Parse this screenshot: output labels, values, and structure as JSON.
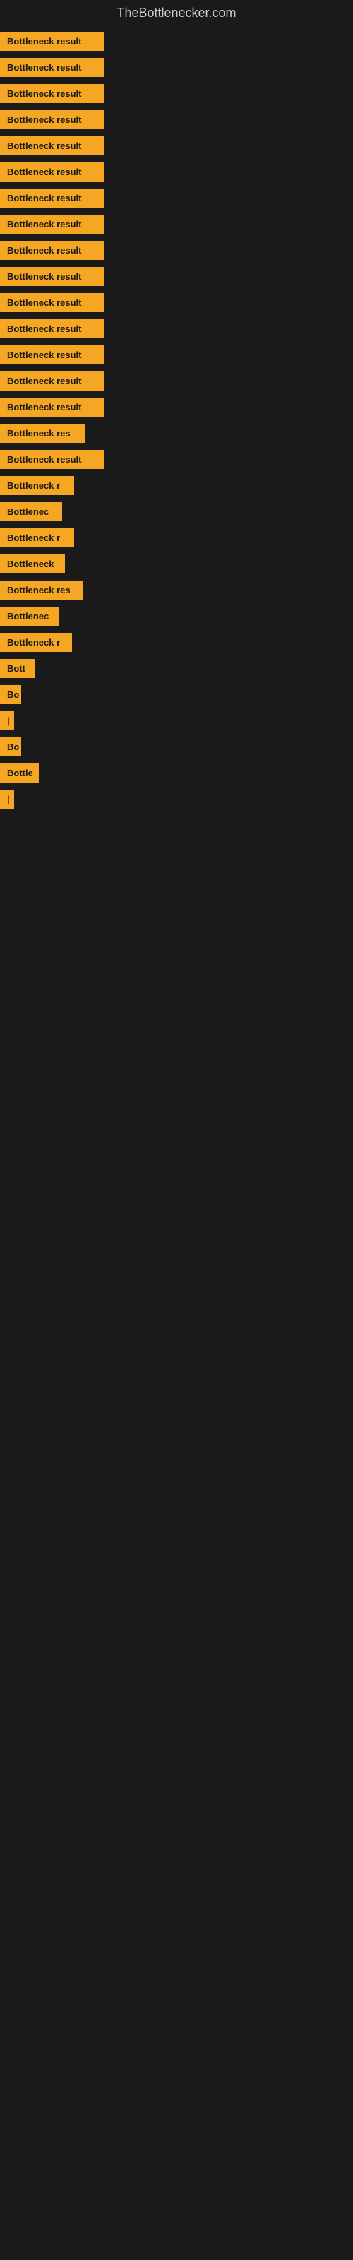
{
  "site": {
    "title": "TheBottlenecker.com"
  },
  "items": [
    {
      "label": "Bottleneck result",
      "label_width": 148
    },
    {
      "label": "Bottleneck result",
      "label_width": 148
    },
    {
      "label": "Bottleneck result",
      "label_width": 148
    },
    {
      "label": "Bottleneck result",
      "label_width": 148
    },
    {
      "label": "Bottleneck result",
      "label_width": 148
    },
    {
      "label": "Bottleneck result",
      "label_width": 148
    },
    {
      "label": "Bottleneck result",
      "label_width": 148
    },
    {
      "label": "Bottleneck result",
      "label_width": 148
    },
    {
      "label": "Bottleneck result",
      "label_width": 148
    },
    {
      "label": "Bottleneck result",
      "label_width": 148
    },
    {
      "label": "Bottleneck result",
      "label_width": 148
    },
    {
      "label": "Bottleneck result",
      "label_width": 148
    },
    {
      "label": "Bottleneck result",
      "label_width": 148
    },
    {
      "label": "Bottleneck result",
      "label_width": 148
    },
    {
      "label": "Bottleneck result",
      "label_width": 148
    },
    {
      "label": "Bottleneck res",
      "label_width": 120
    },
    {
      "label": "Bottleneck result",
      "label_width": 148
    },
    {
      "label": "Bottleneck r",
      "label_width": 105
    },
    {
      "label": "Bottlenec",
      "label_width": 88
    },
    {
      "label": "Bottleneck r",
      "label_width": 105
    },
    {
      "label": "Bottleneck",
      "label_width": 92
    },
    {
      "label": "Bottleneck res",
      "label_width": 118
    },
    {
      "label": "Bottlenec",
      "label_width": 84
    },
    {
      "label": "Bottleneck r",
      "label_width": 102
    },
    {
      "label": "Bott",
      "label_width": 50
    },
    {
      "label": "Bo",
      "label_width": 30
    },
    {
      "label": "|",
      "label_width": 12
    },
    {
      "label": "Bo",
      "label_width": 30
    },
    {
      "label": "Bottle",
      "label_width": 55
    },
    {
      "label": "|",
      "label_width": 10
    }
  ]
}
